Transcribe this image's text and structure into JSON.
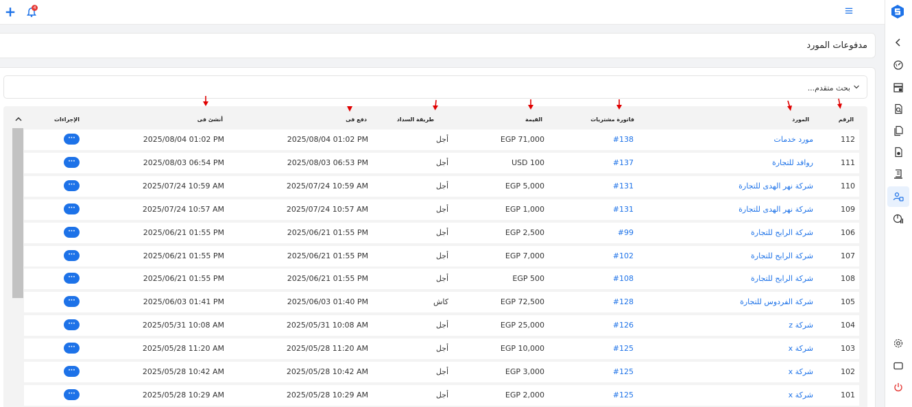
{
  "topbar": {
    "add_icon": "plus-icon",
    "notification_icon": "bell-icon",
    "notification_count": "4",
    "menu_icon": "hamburger-icon"
  },
  "sidebar": {
    "items": [
      {
        "icon": "chevron-left-icon"
      },
      {
        "icon": "dashboard-gauge-icon"
      },
      {
        "icon": "register-icon"
      },
      {
        "icon": "search-document-icon"
      },
      {
        "icon": "documents-icon"
      },
      {
        "icon": "document-settings-icon"
      },
      {
        "icon": "receipt-icon"
      },
      {
        "icon": "users-icon"
      },
      {
        "icon": "report-chart-icon"
      },
      {
        "icon": "gear-icon"
      },
      {
        "icon": "monitor-icon"
      },
      {
        "icon": "power-icon"
      }
    ],
    "colors": {
      "accent": "#1d72e8",
      "power": "#e53935"
    }
  },
  "page": {
    "title": "مدفوعات المورد"
  },
  "search": {
    "advanced_label": "بحث متقدم..."
  },
  "table": {
    "headers": {
      "number": "الرقم",
      "supplier": "المورد",
      "invoice": "فاتورة مشتريات",
      "value": "القيمة",
      "method": "طريقة السداد",
      "paid_at": "دفع فى",
      "created_at": "أنشئ فى",
      "actions": "الإجراءات"
    },
    "action_label": "···",
    "rows": [
      {
        "number": "112",
        "supplier": "مورد خدمات",
        "invoice": "#138",
        "value": "EGP 71,000",
        "method": "أجل",
        "paid_at": "2025/08/04 01:02 PM",
        "created_at": "2025/08/04 01:02 PM"
      },
      {
        "number": "111",
        "supplier": "روافد للتجارة",
        "invoice": "#137",
        "value": "USD 100",
        "method": "أجل",
        "paid_at": "2025/08/03 06:53 PM",
        "created_at": "2025/08/03 06:54 PM"
      },
      {
        "number": "110",
        "supplier": "شركة  نهر الهدى للتجارة",
        "invoice": "#131",
        "value": "EGP 5,000",
        "method": "أجل",
        "paid_at": "2025/07/24 10:59 AM",
        "created_at": "2025/07/24 10:59 AM"
      },
      {
        "number": "109",
        "supplier": "شركة  نهر الهدى للتجارة",
        "invoice": "#131",
        "value": "EGP 1,000",
        "method": "أجل",
        "paid_at": "2025/07/24 10:57 AM",
        "created_at": "2025/07/24 10:57 AM"
      },
      {
        "number": "106",
        "supplier": "شركة الرابح للتجارة",
        "invoice": "#99",
        "value": "EGP 2,500",
        "method": "أجل",
        "paid_at": "2025/06/21 01:55 PM",
        "created_at": "2025/06/21 01:55 PM"
      },
      {
        "number": "107",
        "supplier": "شركة الرابح للتجارة",
        "invoice": "#102",
        "value": "EGP 7,000",
        "method": "أجل",
        "paid_at": "2025/06/21 01:55 PM",
        "created_at": "2025/06/21 01:55 PM"
      },
      {
        "number": "108",
        "supplier": "شركة الرابح للتجارة",
        "invoice": "#108",
        "value": "EGP 500",
        "method": "أجل",
        "paid_at": "2025/06/21 01:55 PM",
        "created_at": "2025/06/21 01:55 PM"
      },
      {
        "number": "105",
        "supplier": "شركة الفردوس للتجارة",
        "invoice": "#128",
        "value": "EGP 72,500",
        "method": "كاش",
        "paid_at": "2025/06/03 01:40 PM",
        "created_at": "2025/06/03 01:41 PM"
      },
      {
        "number": "104",
        "supplier": "شركة z",
        "invoice": "#126",
        "value": "EGP 25,000",
        "method": "أجل",
        "paid_at": "2025/05/31 10:08 AM",
        "created_at": "2025/05/31 10:08 AM"
      },
      {
        "number": "103",
        "supplier": "شركة x",
        "invoice": "#125",
        "value": "EGP 10,000",
        "method": "أجل",
        "paid_at": "2025/05/28 11:20 AM",
        "created_at": "2025/05/28 11:20 AM"
      },
      {
        "number": "102",
        "supplier": "شركة x",
        "invoice": "#125",
        "value": "EGP 3,000",
        "method": "أجل",
        "paid_at": "2025/05/28 10:42 AM",
        "created_at": "2025/05/28 10:42 AM"
      },
      {
        "number": "101",
        "supplier": "شركة x",
        "invoice": "#125",
        "value": "EGP 2,000",
        "method": "أجل",
        "paid_at": "2025/05/28 10:29 AM",
        "created_at": "2025/05/28 10:29 AM"
      }
    ]
  },
  "annotation_color": "#e00000"
}
